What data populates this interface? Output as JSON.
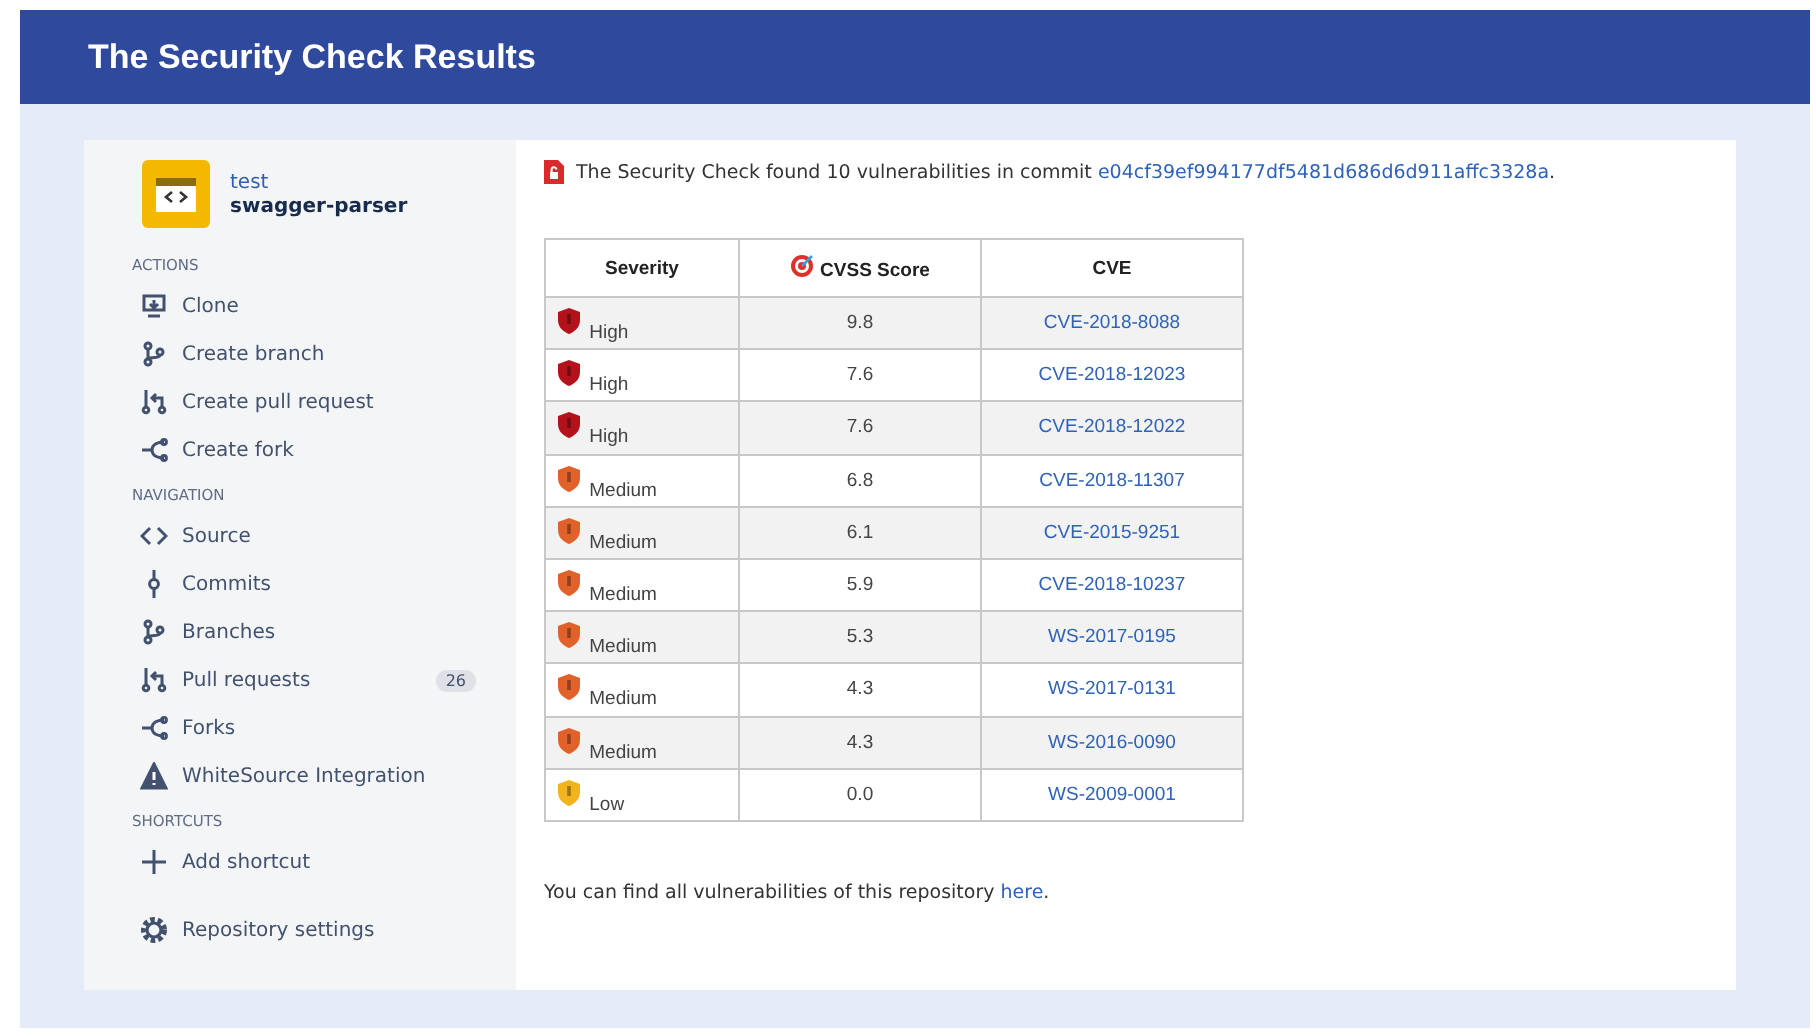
{
  "header": {
    "title": "The Security Check Results"
  },
  "repo": {
    "project": "test",
    "name": "swagger-parser"
  },
  "sidebar": [
    {
      "heading": "ACTIONS",
      "items": [
        {
          "label": "Clone"
        },
        {
          "label": "Create branch"
        },
        {
          "label": "Create pull request"
        },
        {
          "label": "Create fork"
        }
      ]
    },
    {
      "heading": "NAVIGATION",
      "items": [
        {
          "label": "Source"
        },
        {
          "label": "Commits"
        },
        {
          "label": "Branches"
        },
        {
          "label": "Pull requests",
          "count": "26"
        },
        {
          "label": "Forks"
        },
        {
          "label": "WhiteSource Integration"
        }
      ]
    },
    {
      "heading": "SHORTCUTS",
      "items": [
        {
          "label": "Add shortcut"
        }
      ]
    }
  ],
  "settings": {
    "label": "Repository settings"
  },
  "summary": {
    "text": "The Security Check found 10 vulnerabilities in commit",
    "commit": "e04cf39ef994177df5481d686d6d911affc3328a",
    "end": "."
  },
  "table": {
    "columns": [
      "Severity",
      "CVSS Score",
      "CVE"
    ],
    "rows": [
      {
        "kind": "high",
        "severity": "High",
        "score": "9.8",
        "cve": "CVE-2018-8088"
      },
      {
        "kind": "high",
        "severity": "High",
        "score": "7.6",
        "cve": "CVE-2018-12023"
      },
      {
        "kind": "high",
        "severity": "High",
        "score": "7.6",
        "cve": "CVE-2018-12022"
      },
      {
        "kind": "medium",
        "severity": "Medium",
        "score": "6.8",
        "cve": "CVE-2018-11307"
      },
      {
        "kind": "medium",
        "severity": "Medium",
        "score": "6.1",
        "cve": "CVE-2015-9251"
      },
      {
        "kind": "medium",
        "severity": "Medium",
        "score": "5.9",
        "cve": "CVE-2018-10237"
      },
      {
        "kind": "medium",
        "severity": "Medium",
        "score": "5.3",
        "cve": "WS-2017-0195"
      },
      {
        "kind": "medium",
        "severity": "Medium",
        "score": "4.3",
        "cve": "WS-2017-0131"
      },
      {
        "kind": "medium",
        "severity": "Medium",
        "score": "4.3",
        "cve": "WS-2016-0090"
      },
      {
        "kind": "low",
        "severity": "Low",
        "score": "0.0",
        "cve": "WS-2009-0001"
      }
    ]
  },
  "footer": {
    "text": "You can find all vulnerabilities of this repository",
    "link": "here",
    "end": "."
  }
}
